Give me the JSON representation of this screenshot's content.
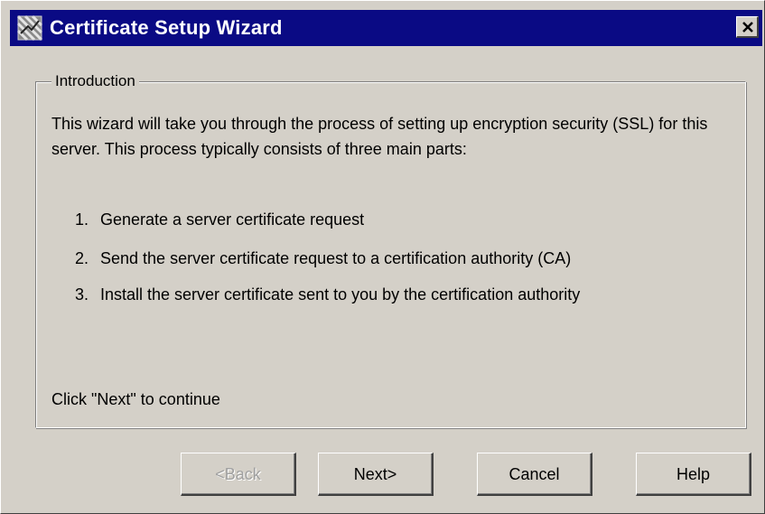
{
  "window": {
    "title": "Certificate Setup Wizard",
    "close_glyph": "✕"
  },
  "group": {
    "legend": "Introduction",
    "intro": "This wizard will take you through the process of setting up encryption security (SSL) for this server.  This process typically consists of three main parts:",
    "steps": [
      {
        "num": "1.",
        "text": "Generate a server certificate request"
      },
      {
        "num": "2.",
        "text": "Send the server certificate request to a certification authority (CA)"
      },
      {
        "num": "3.",
        "text": "Install the server certificate sent to you by the certification authority"
      }
    ],
    "continue": "Click \"Next\" to continue"
  },
  "buttons": {
    "back": "<Back",
    "next": "Next>",
    "cancel": "Cancel",
    "help": "Help"
  },
  "icons": {
    "title": "certificate-wizard-icon",
    "close": "close-icon"
  },
  "colors": {
    "titlebar": "#0a0a84",
    "face": "#d4d0c8",
    "disabled_text": "#a0a0a0"
  }
}
